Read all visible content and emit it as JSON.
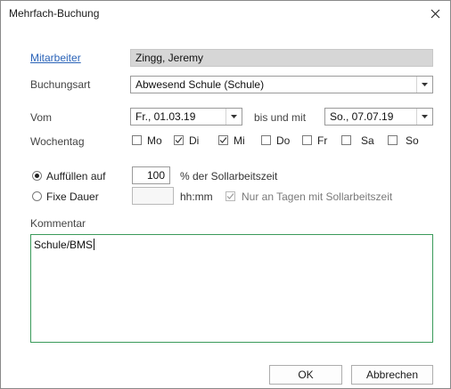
{
  "window": {
    "title": "Mehrfach-Buchung"
  },
  "fields": {
    "mitarbeiter_label": "Mitarbeiter",
    "mitarbeiter_value": "Zingg, Jeremy",
    "buchungsart_label": "Buchungsart",
    "buchungsart_value": "Abwesend Schule (Schule)",
    "vom_label": "Vom",
    "vom_value": "Fr., 01.03.19",
    "bis_label": "bis und mit",
    "bis_value": "So., 07.07.19",
    "wochentag_label": "Wochentag"
  },
  "weekdays": [
    {
      "label": "Mo",
      "checked": false
    },
    {
      "label": "Di",
      "checked": true
    },
    {
      "label": "Mi",
      "checked": true
    },
    {
      "label": "Do",
      "checked": false
    },
    {
      "label": "Fr",
      "checked": false
    },
    {
      "label": "Sa",
      "checked": false
    },
    {
      "label": "So",
      "checked": false
    }
  ],
  "mode": {
    "auffuellen_label": "Auffüllen auf",
    "auffuellen_selected": true,
    "auffuellen_value": "100",
    "auffuellen_suffix": "% der Sollarbeitszeit",
    "fixe_label": "Fixe Dauer",
    "fixe_selected": false,
    "fixe_value": "",
    "fixe_unit": "hh:mm",
    "nur_tagen_label": "Nur an Tagen mit Sollarbeitszeit",
    "nur_tagen_checked": true
  },
  "kommentar": {
    "label": "Kommentar",
    "value": "Schule/BMS"
  },
  "buttons": {
    "ok": "OK",
    "cancel": "Abbrechen"
  },
  "colors": {
    "link": "#2a63b8",
    "focus_border": "#3a9a5a",
    "readonly_bg": "#d6d6d6"
  },
  "icons": {
    "close": "close-icon",
    "dropdown": "chevron-down-icon",
    "check": "checkmark-icon"
  }
}
